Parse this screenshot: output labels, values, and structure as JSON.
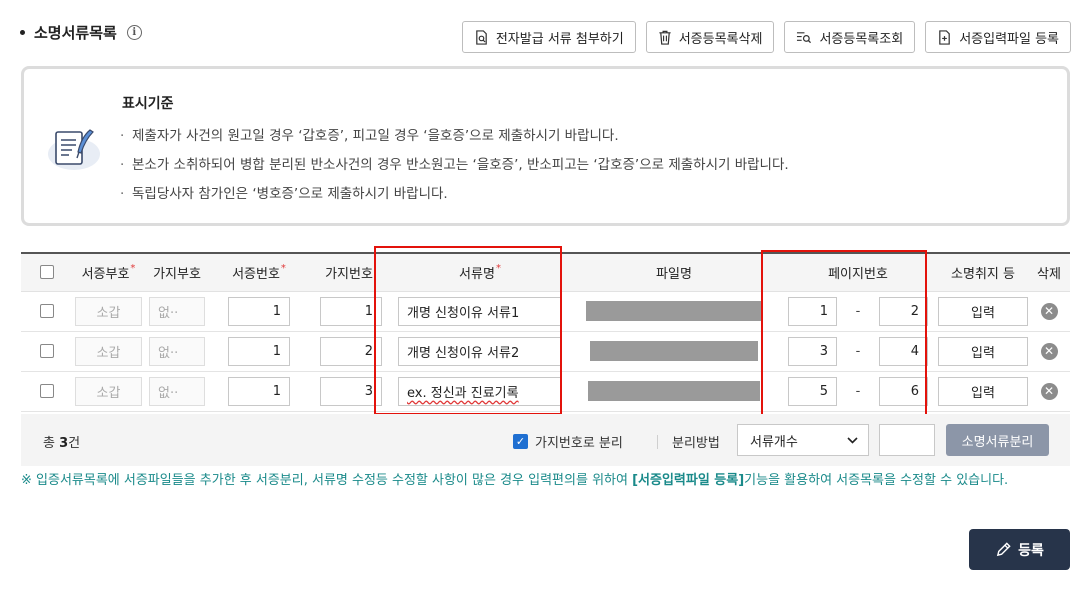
{
  "section": {
    "title": "소명서류목록",
    "info_icon": "info-icon"
  },
  "toolbar": {
    "attach_label": "전자발급 서류 첨부하기",
    "delete_label": "서증등목록삭제",
    "view_label": "서증등목록조회",
    "upload_label": "서증입력파일 등록"
  },
  "criteria": {
    "title": "표시기준",
    "items": [
      "제출자가 사건의 원고일 경우 ‘갑호증’, 피고일 경우 ‘을호증’으로 제출하시기 바랍니다.",
      "본소가 소취하되어 병합 분리된 반소사건의 경우 반소원고는 ‘을호증’, 반소피고는 ‘갑호증’으로 제출하시기 바랍니다.",
      "독립당사자 참가인은 ‘병호증’으로 제출하시기 바랍니다."
    ]
  },
  "table": {
    "headers": {
      "evidence_code": "서증부호",
      "branch_code": "가지부호",
      "evidence_no": "서증번호",
      "branch_no": "가지번호",
      "doc_name": "서류명",
      "file_name": "파일명",
      "page_no": "페이지번호",
      "cancel": "소명취지 등",
      "delete": "삭제"
    },
    "required_mark": "*",
    "page_sep": "-",
    "rows": [
      {
        "code": "소갑",
        "branch": "없··",
        "evidence_no": "1",
        "branch_no": "1",
        "doc_name": "개명 신청이유 서류1",
        "page_from": "1",
        "page_to": "2",
        "input_label": "입력"
      },
      {
        "code": "소갑",
        "branch": "없··",
        "evidence_no": "1",
        "branch_no": "2",
        "doc_name": "개명 신청이유 서류2",
        "page_from": "3",
        "page_to": "4",
        "input_label": "입력"
      },
      {
        "code": "소갑",
        "branch": "없··",
        "evidence_no": "1",
        "branch_no": "3",
        "doc_name": "ex. 정신과 진료기록",
        "page_from": "5",
        "page_to": "6",
        "input_label": "입력"
      }
    ]
  },
  "summary": {
    "total_prefix": "총",
    "total_count": "3",
    "total_suffix": "건",
    "split_by_branch": "가지번호로 분리",
    "split_method_label": "분리방법",
    "split_method_value": "서류개수",
    "split_button": "소명서류분리"
  },
  "notice": {
    "prefix": "※ 입증서류목록에 서증파일들을 추가한 후 서증분리, 서류명 수정등 수정할 사항이 많은 경우 입력편의를 위하여 ",
    "highlight": "[서증입력파일 등록]",
    "suffix": "기능을 활용하여 서증목록을 수정할 수 있습니다."
  },
  "register_button": "등록",
  "colors": {
    "accent": "#27344a",
    "highlight_box": "#e3120b",
    "notice": "#1a8a8a",
    "checkbox": "#1f6fd1"
  }
}
